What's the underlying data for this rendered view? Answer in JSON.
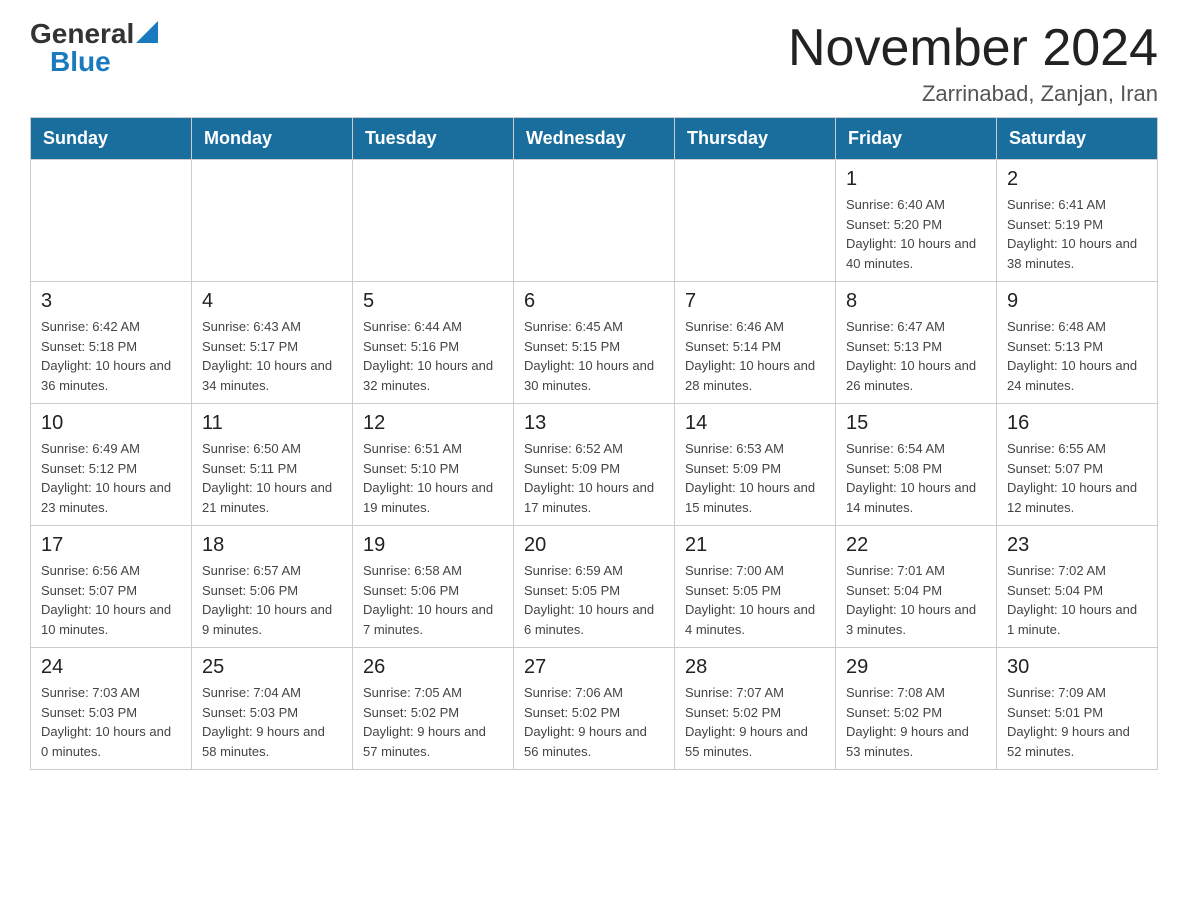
{
  "header": {
    "logo_general": "General",
    "logo_blue": "Blue",
    "month_title": "November 2024",
    "location": "Zarrinabad, Zanjan, Iran"
  },
  "weekdays": [
    "Sunday",
    "Monday",
    "Tuesday",
    "Wednesday",
    "Thursday",
    "Friday",
    "Saturday"
  ],
  "rows": [
    [
      {
        "day": "",
        "info": ""
      },
      {
        "day": "",
        "info": ""
      },
      {
        "day": "",
        "info": ""
      },
      {
        "day": "",
        "info": ""
      },
      {
        "day": "",
        "info": ""
      },
      {
        "day": "1",
        "info": "Sunrise: 6:40 AM\nSunset: 5:20 PM\nDaylight: 10 hours and 40 minutes."
      },
      {
        "day": "2",
        "info": "Sunrise: 6:41 AM\nSunset: 5:19 PM\nDaylight: 10 hours and 38 minutes."
      }
    ],
    [
      {
        "day": "3",
        "info": "Sunrise: 6:42 AM\nSunset: 5:18 PM\nDaylight: 10 hours and 36 minutes."
      },
      {
        "day": "4",
        "info": "Sunrise: 6:43 AM\nSunset: 5:17 PM\nDaylight: 10 hours and 34 minutes."
      },
      {
        "day": "5",
        "info": "Sunrise: 6:44 AM\nSunset: 5:16 PM\nDaylight: 10 hours and 32 minutes."
      },
      {
        "day": "6",
        "info": "Sunrise: 6:45 AM\nSunset: 5:15 PM\nDaylight: 10 hours and 30 minutes."
      },
      {
        "day": "7",
        "info": "Sunrise: 6:46 AM\nSunset: 5:14 PM\nDaylight: 10 hours and 28 minutes."
      },
      {
        "day": "8",
        "info": "Sunrise: 6:47 AM\nSunset: 5:13 PM\nDaylight: 10 hours and 26 minutes."
      },
      {
        "day": "9",
        "info": "Sunrise: 6:48 AM\nSunset: 5:13 PM\nDaylight: 10 hours and 24 minutes."
      }
    ],
    [
      {
        "day": "10",
        "info": "Sunrise: 6:49 AM\nSunset: 5:12 PM\nDaylight: 10 hours and 23 minutes."
      },
      {
        "day": "11",
        "info": "Sunrise: 6:50 AM\nSunset: 5:11 PM\nDaylight: 10 hours and 21 minutes."
      },
      {
        "day": "12",
        "info": "Sunrise: 6:51 AM\nSunset: 5:10 PM\nDaylight: 10 hours and 19 minutes."
      },
      {
        "day": "13",
        "info": "Sunrise: 6:52 AM\nSunset: 5:09 PM\nDaylight: 10 hours and 17 minutes."
      },
      {
        "day": "14",
        "info": "Sunrise: 6:53 AM\nSunset: 5:09 PM\nDaylight: 10 hours and 15 minutes."
      },
      {
        "day": "15",
        "info": "Sunrise: 6:54 AM\nSunset: 5:08 PM\nDaylight: 10 hours and 14 minutes."
      },
      {
        "day": "16",
        "info": "Sunrise: 6:55 AM\nSunset: 5:07 PM\nDaylight: 10 hours and 12 minutes."
      }
    ],
    [
      {
        "day": "17",
        "info": "Sunrise: 6:56 AM\nSunset: 5:07 PM\nDaylight: 10 hours and 10 minutes."
      },
      {
        "day": "18",
        "info": "Sunrise: 6:57 AM\nSunset: 5:06 PM\nDaylight: 10 hours and 9 minutes."
      },
      {
        "day": "19",
        "info": "Sunrise: 6:58 AM\nSunset: 5:06 PM\nDaylight: 10 hours and 7 minutes."
      },
      {
        "day": "20",
        "info": "Sunrise: 6:59 AM\nSunset: 5:05 PM\nDaylight: 10 hours and 6 minutes."
      },
      {
        "day": "21",
        "info": "Sunrise: 7:00 AM\nSunset: 5:05 PM\nDaylight: 10 hours and 4 minutes."
      },
      {
        "day": "22",
        "info": "Sunrise: 7:01 AM\nSunset: 5:04 PM\nDaylight: 10 hours and 3 minutes."
      },
      {
        "day": "23",
        "info": "Sunrise: 7:02 AM\nSunset: 5:04 PM\nDaylight: 10 hours and 1 minute."
      }
    ],
    [
      {
        "day": "24",
        "info": "Sunrise: 7:03 AM\nSunset: 5:03 PM\nDaylight: 10 hours and 0 minutes."
      },
      {
        "day": "25",
        "info": "Sunrise: 7:04 AM\nSunset: 5:03 PM\nDaylight: 9 hours and 58 minutes."
      },
      {
        "day": "26",
        "info": "Sunrise: 7:05 AM\nSunset: 5:02 PM\nDaylight: 9 hours and 57 minutes."
      },
      {
        "day": "27",
        "info": "Sunrise: 7:06 AM\nSunset: 5:02 PM\nDaylight: 9 hours and 56 minutes."
      },
      {
        "day": "28",
        "info": "Sunrise: 7:07 AM\nSunset: 5:02 PM\nDaylight: 9 hours and 55 minutes."
      },
      {
        "day": "29",
        "info": "Sunrise: 7:08 AM\nSunset: 5:02 PM\nDaylight: 9 hours and 53 minutes."
      },
      {
        "day": "30",
        "info": "Sunrise: 7:09 AM\nSunset: 5:01 PM\nDaylight: 9 hours and 52 minutes."
      }
    ]
  ]
}
